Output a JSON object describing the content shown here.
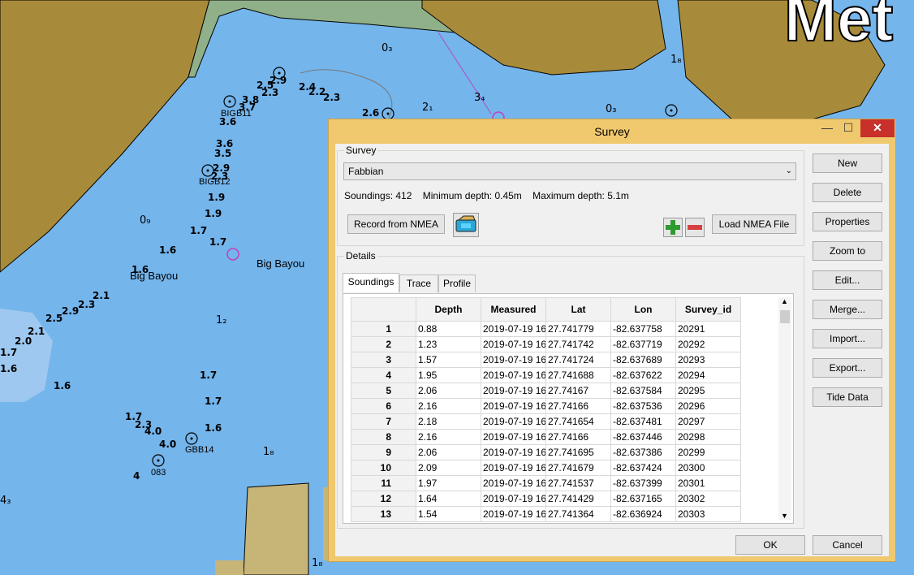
{
  "chart_soundings": {
    "depths": [
      "0.88",
      "1.23",
      "1.57",
      "1.95",
      "2.06",
      "2.16",
      "2.18",
      "2.16",
      "2.06",
      "2.09",
      "1.97",
      "1.64",
      "1.54"
    ]
  },
  "map": {
    "labels": {
      "big_bayou_1": "Big Bayou",
      "big_bayou_2": "Big Bayou",
      "bigb11": "BIGB11",
      "bigb12": "BIGB12",
      "gbb14": "GBB14",
      "b083": "083",
      "city": "Met"
    },
    "soundings": [
      {
        "t": "0₃"
      },
      {
        "t": "1₈"
      },
      {
        "t": "2₁"
      },
      {
        "t": "3₄"
      },
      {
        "t": "0₃"
      },
      {
        "t": "0₉"
      },
      {
        "t": "1₂"
      },
      {
        "t": "1₈"
      },
      {
        "t": "4"
      },
      {
        "t": "4₃"
      },
      {
        "t": "1₈"
      },
      {
        "t": "2.5"
      },
      {
        "t": "2.9"
      },
      {
        "t": "2.4"
      },
      {
        "t": "2.3"
      },
      {
        "t": "2.2"
      },
      {
        "t": "2.3"
      },
      {
        "t": "2.6"
      },
      {
        "t": "3.8"
      },
      {
        "t": "3.7"
      },
      {
        "t": "3.6"
      },
      {
        "t": "3.6"
      },
      {
        "t": "3.5"
      },
      {
        "t": "2.9"
      },
      {
        "t": "2.3"
      },
      {
        "t": "1.9"
      },
      {
        "t": "1.9"
      },
      {
        "t": "1.7"
      },
      {
        "t": "1.7"
      },
      {
        "t": "1.6"
      },
      {
        "t": "1.6"
      },
      {
        "t": "2.1"
      },
      {
        "t": "2.3"
      },
      {
        "t": "2.9"
      },
      {
        "t": "2.5"
      },
      {
        "t": "2.1"
      },
      {
        "t": "2.0"
      },
      {
        "t": "1.7"
      },
      {
        "t": "1.6"
      },
      {
        "t": "1.6"
      },
      {
        "t": "1.7"
      },
      {
        "t": "1.7"
      },
      {
        "t": "1.6"
      },
      {
        "t": "1.7"
      },
      {
        "t": "2.3"
      },
      {
        "t": "4.0"
      },
      {
        "t": "4.0"
      }
    ]
  },
  "dialog": {
    "title": "Survey",
    "survey_group_label": "Survey",
    "survey_selected": "Fabbian",
    "stats": {
      "soundings": "Soundings: 412",
      "min_depth": "Minimum depth: 0.45m",
      "max_depth": "Maximum depth: 5.1m"
    },
    "record_label": "Record from NMEA",
    "load_nmea_label": "Load NMEA File",
    "details_label": "Details",
    "tabs": [
      "Soundings",
      "Trace",
      "Profile"
    ],
    "active_tab": 0,
    "columns": [
      "Depth",
      "Measured",
      "Lat",
      "Lon",
      "Survey_id"
    ],
    "rows": [
      {
        "n": "1",
        "depth": "0.88",
        "measured": "2019-07-19 16:",
        "lat": "27.741779",
        "lon": "-82.637758",
        "id": "20291"
      },
      {
        "n": "2",
        "depth": "1.23",
        "measured": "2019-07-19 16:",
        "lat": "27.741742",
        "lon": "-82.637719",
        "id": "20292"
      },
      {
        "n": "3",
        "depth": "1.57",
        "measured": "2019-07-19 16:",
        "lat": "27.741724",
        "lon": "-82.637689",
        "id": "20293"
      },
      {
        "n": "4",
        "depth": "1.95",
        "measured": "2019-07-19 16:",
        "lat": "27.741688",
        "lon": "-82.637622",
        "id": "20294"
      },
      {
        "n": "5",
        "depth": "2.06",
        "measured": "2019-07-19 16:",
        "lat": "27.74167",
        "lon": "-82.637584",
        "id": "20295"
      },
      {
        "n": "6",
        "depth": "2.16",
        "measured": "2019-07-19 16:",
        "lat": "27.74166",
        "lon": "-82.637536",
        "id": "20296"
      },
      {
        "n": "7",
        "depth": "2.18",
        "measured": "2019-07-19 16:",
        "lat": "27.741654",
        "lon": "-82.637481",
        "id": "20297"
      },
      {
        "n": "8",
        "depth": "2.16",
        "measured": "2019-07-19 16:",
        "lat": "27.74166",
        "lon": "-82.637446",
        "id": "20298"
      },
      {
        "n": "9",
        "depth": "2.06",
        "measured": "2019-07-19 16:",
        "lat": "27.741695",
        "lon": "-82.637386",
        "id": "20299"
      },
      {
        "n": "10",
        "depth": "2.09",
        "measured": "2019-07-19 16:",
        "lat": "27.741679",
        "lon": "-82.637424",
        "id": "20300"
      },
      {
        "n": "11",
        "depth": "1.97",
        "measured": "2019-07-19 16:",
        "lat": "27.741537",
        "lon": "-82.637399",
        "id": "20301"
      },
      {
        "n": "12",
        "depth": "1.64",
        "measured": "2019-07-19 16:",
        "lat": "27.741429",
        "lon": "-82.637165",
        "id": "20302"
      },
      {
        "n": "13",
        "depth": "1.54",
        "measured": "2019-07-19 16:",
        "lat": "27.741364",
        "lon": "-82.636924",
        "id": "20303"
      }
    ],
    "side_buttons": [
      "New",
      "Delete",
      "Properties",
      "Zoom to",
      "Edit...",
      "Merge...",
      "Import...",
      "Export...",
      "Tide Data"
    ],
    "ok_label": "OK",
    "cancel_label": "Cancel"
  }
}
